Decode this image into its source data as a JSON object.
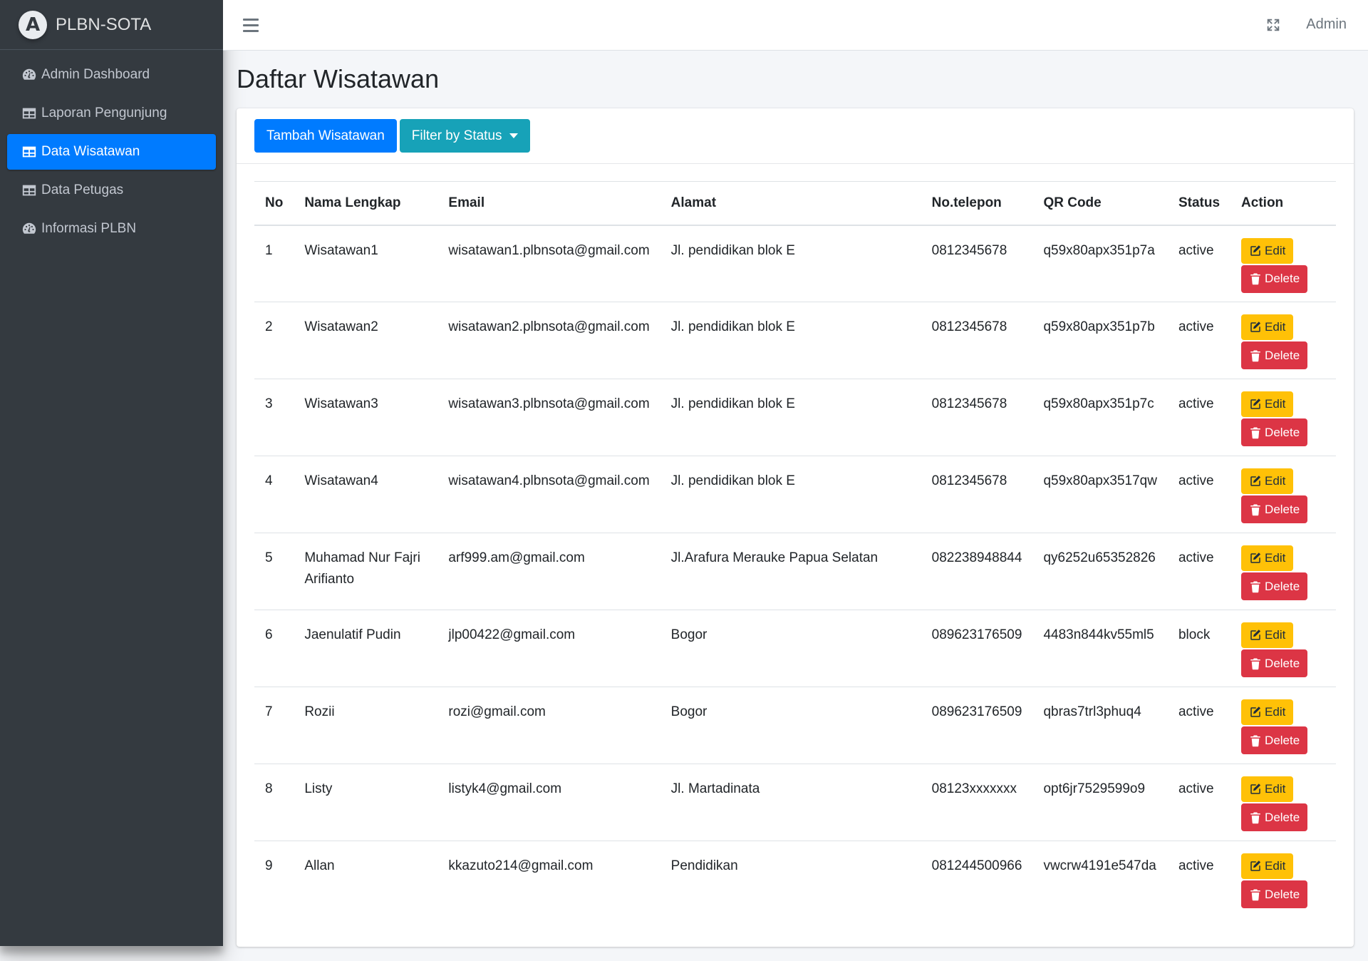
{
  "brand": {
    "logo_letter": "A",
    "name": "PLBN-SOTA"
  },
  "sidebar": {
    "items": [
      {
        "label": "Admin Dashboard",
        "icon": "tachometer-icon",
        "active": false
      },
      {
        "label": "Laporan Pengunjung",
        "icon": "table-icon",
        "active": false
      },
      {
        "label": "Data Wisatawan",
        "icon": "table-icon",
        "active": true
      },
      {
        "label": "Data Petugas",
        "icon": "table-icon",
        "active": false
      },
      {
        "label": "Informasi PLBN",
        "icon": "tachometer-icon",
        "active": false
      }
    ]
  },
  "topbar": {
    "admin_label": "Admin"
  },
  "page": {
    "title": "Daftar Wisatawan"
  },
  "toolbar": {
    "add_label": "Tambah Wisatawan",
    "filter_label": "Filter by Status"
  },
  "table": {
    "headers": [
      "No",
      "Nama Lengkap",
      "Email",
      "Alamat",
      "No.telepon",
      "QR Code",
      "Status",
      "Action"
    ],
    "rows": [
      {
        "no": "1",
        "name": "Wisatawan1",
        "email": "wisatawan1.plbnsota@gmail.com",
        "address": "Jl. pendidikan blok E",
        "phone": "0812345678",
        "qr": "q59x80apx351p7a",
        "status": "active"
      },
      {
        "no": "2",
        "name": "Wisatawan2",
        "email": "wisatawan2.plbnsota@gmail.com",
        "address": "Jl. pendidikan blok E",
        "phone": "0812345678",
        "qr": "q59x80apx351p7b",
        "status": "active"
      },
      {
        "no": "3",
        "name": "Wisatawan3",
        "email": "wisatawan3.plbnsota@gmail.com",
        "address": "Jl. pendidikan blok E",
        "phone": "0812345678",
        "qr": "q59x80apx351p7c",
        "status": "active"
      },
      {
        "no": "4",
        "name": "Wisatawan4",
        "email": "wisatawan4.plbnsota@gmail.com",
        "address": "Jl. pendidikan blok E",
        "phone": "0812345678",
        "qr": "q59x80apx3517qw",
        "status": "active"
      },
      {
        "no": "5",
        "name": "Muhamad Nur Fajri Arifianto",
        "email": "arf999.am@gmail.com",
        "address": "Jl.Arafura Merauke Papua Selatan",
        "phone": "082238948844",
        "qr": "qy6252u65352826",
        "status": "active"
      },
      {
        "no": "6",
        "name": "Jaenulatif Pudin",
        "email": "jlp00422@gmail.com",
        "address": "Bogor",
        "phone": "089623176509",
        "qr": "4483n844kv55ml5",
        "status": "block"
      },
      {
        "no": "7",
        "name": "Rozii",
        "email": "rozi@gmail.com",
        "address": "Bogor",
        "phone": "089623176509",
        "qr": "qbras7trl3phuq4",
        "status": "active"
      },
      {
        "no": "8",
        "name": "Listy",
        "email": "listyk4@gmail.com",
        "address": "Jl. Martadinata",
        "phone": "08123xxxxxxx",
        "qr": "opt6jr7529599o9",
        "status": "active"
      },
      {
        "no": "9",
        "name": "Allan",
        "email": "kkazuto214@gmail.com",
        "address": "Pendidikan",
        "phone": "081244500966",
        "qr": "vwcrw4191e547da",
        "status": "active"
      }
    ],
    "edit_label": "Edit",
    "delete_label": "Delete"
  },
  "colors": {
    "sidebar": "#343a40",
    "primary": "#007bff",
    "info": "#17a2b8",
    "warning": "#ffc107",
    "danger": "#dc3545"
  }
}
